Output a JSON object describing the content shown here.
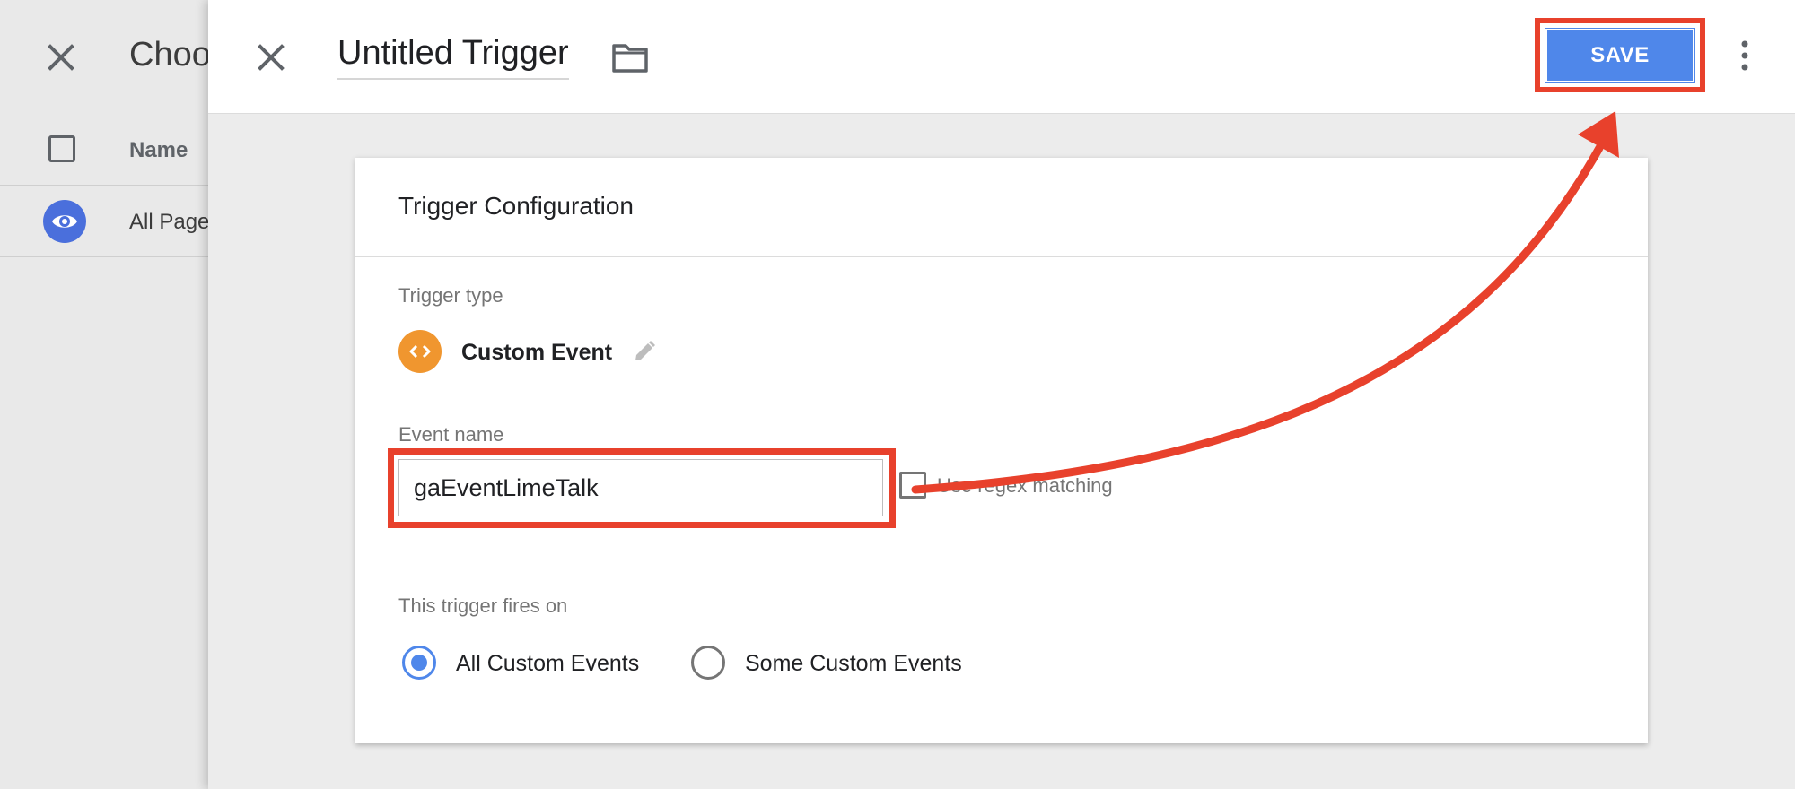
{
  "background_panel": {
    "close_icon": "close-icon",
    "title": "Choo",
    "select_all_checkbox": "checkbox-icon",
    "column_header": "Name",
    "row": {
      "icon": "eye-icon",
      "label": "All Page"
    }
  },
  "editor": {
    "close_icon": "close-icon",
    "title": "Untitled Trigger",
    "folder_icon": "folder-icon",
    "save_label": "SAVE",
    "more_icon": "more-vert-icon"
  },
  "trigger_configuration": {
    "heading": "Trigger Configuration",
    "trigger_type_label": "Trigger type",
    "trigger_type": {
      "icon": "code-brackets-icon",
      "name": "Custom Event",
      "edit_icon": "pencil-icon"
    },
    "event_name_label": "Event name",
    "event_name_value": "gaEventLimeTalk",
    "regex_label": "Use regex matching",
    "regex_checked": false,
    "fires_on_label": "This trigger fires on",
    "fires_on_options": [
      {
        "label": "All Custom Events",
        "selected": true
      },
      {
        "label": "Some Custom Events",
        "selected": false
      }
    ]
  },
  "colors": {
    "accent": "#4f87ea",
    "annotation": "#e8412c",
    "trigger_icon": "#f0962f"
  }
}
